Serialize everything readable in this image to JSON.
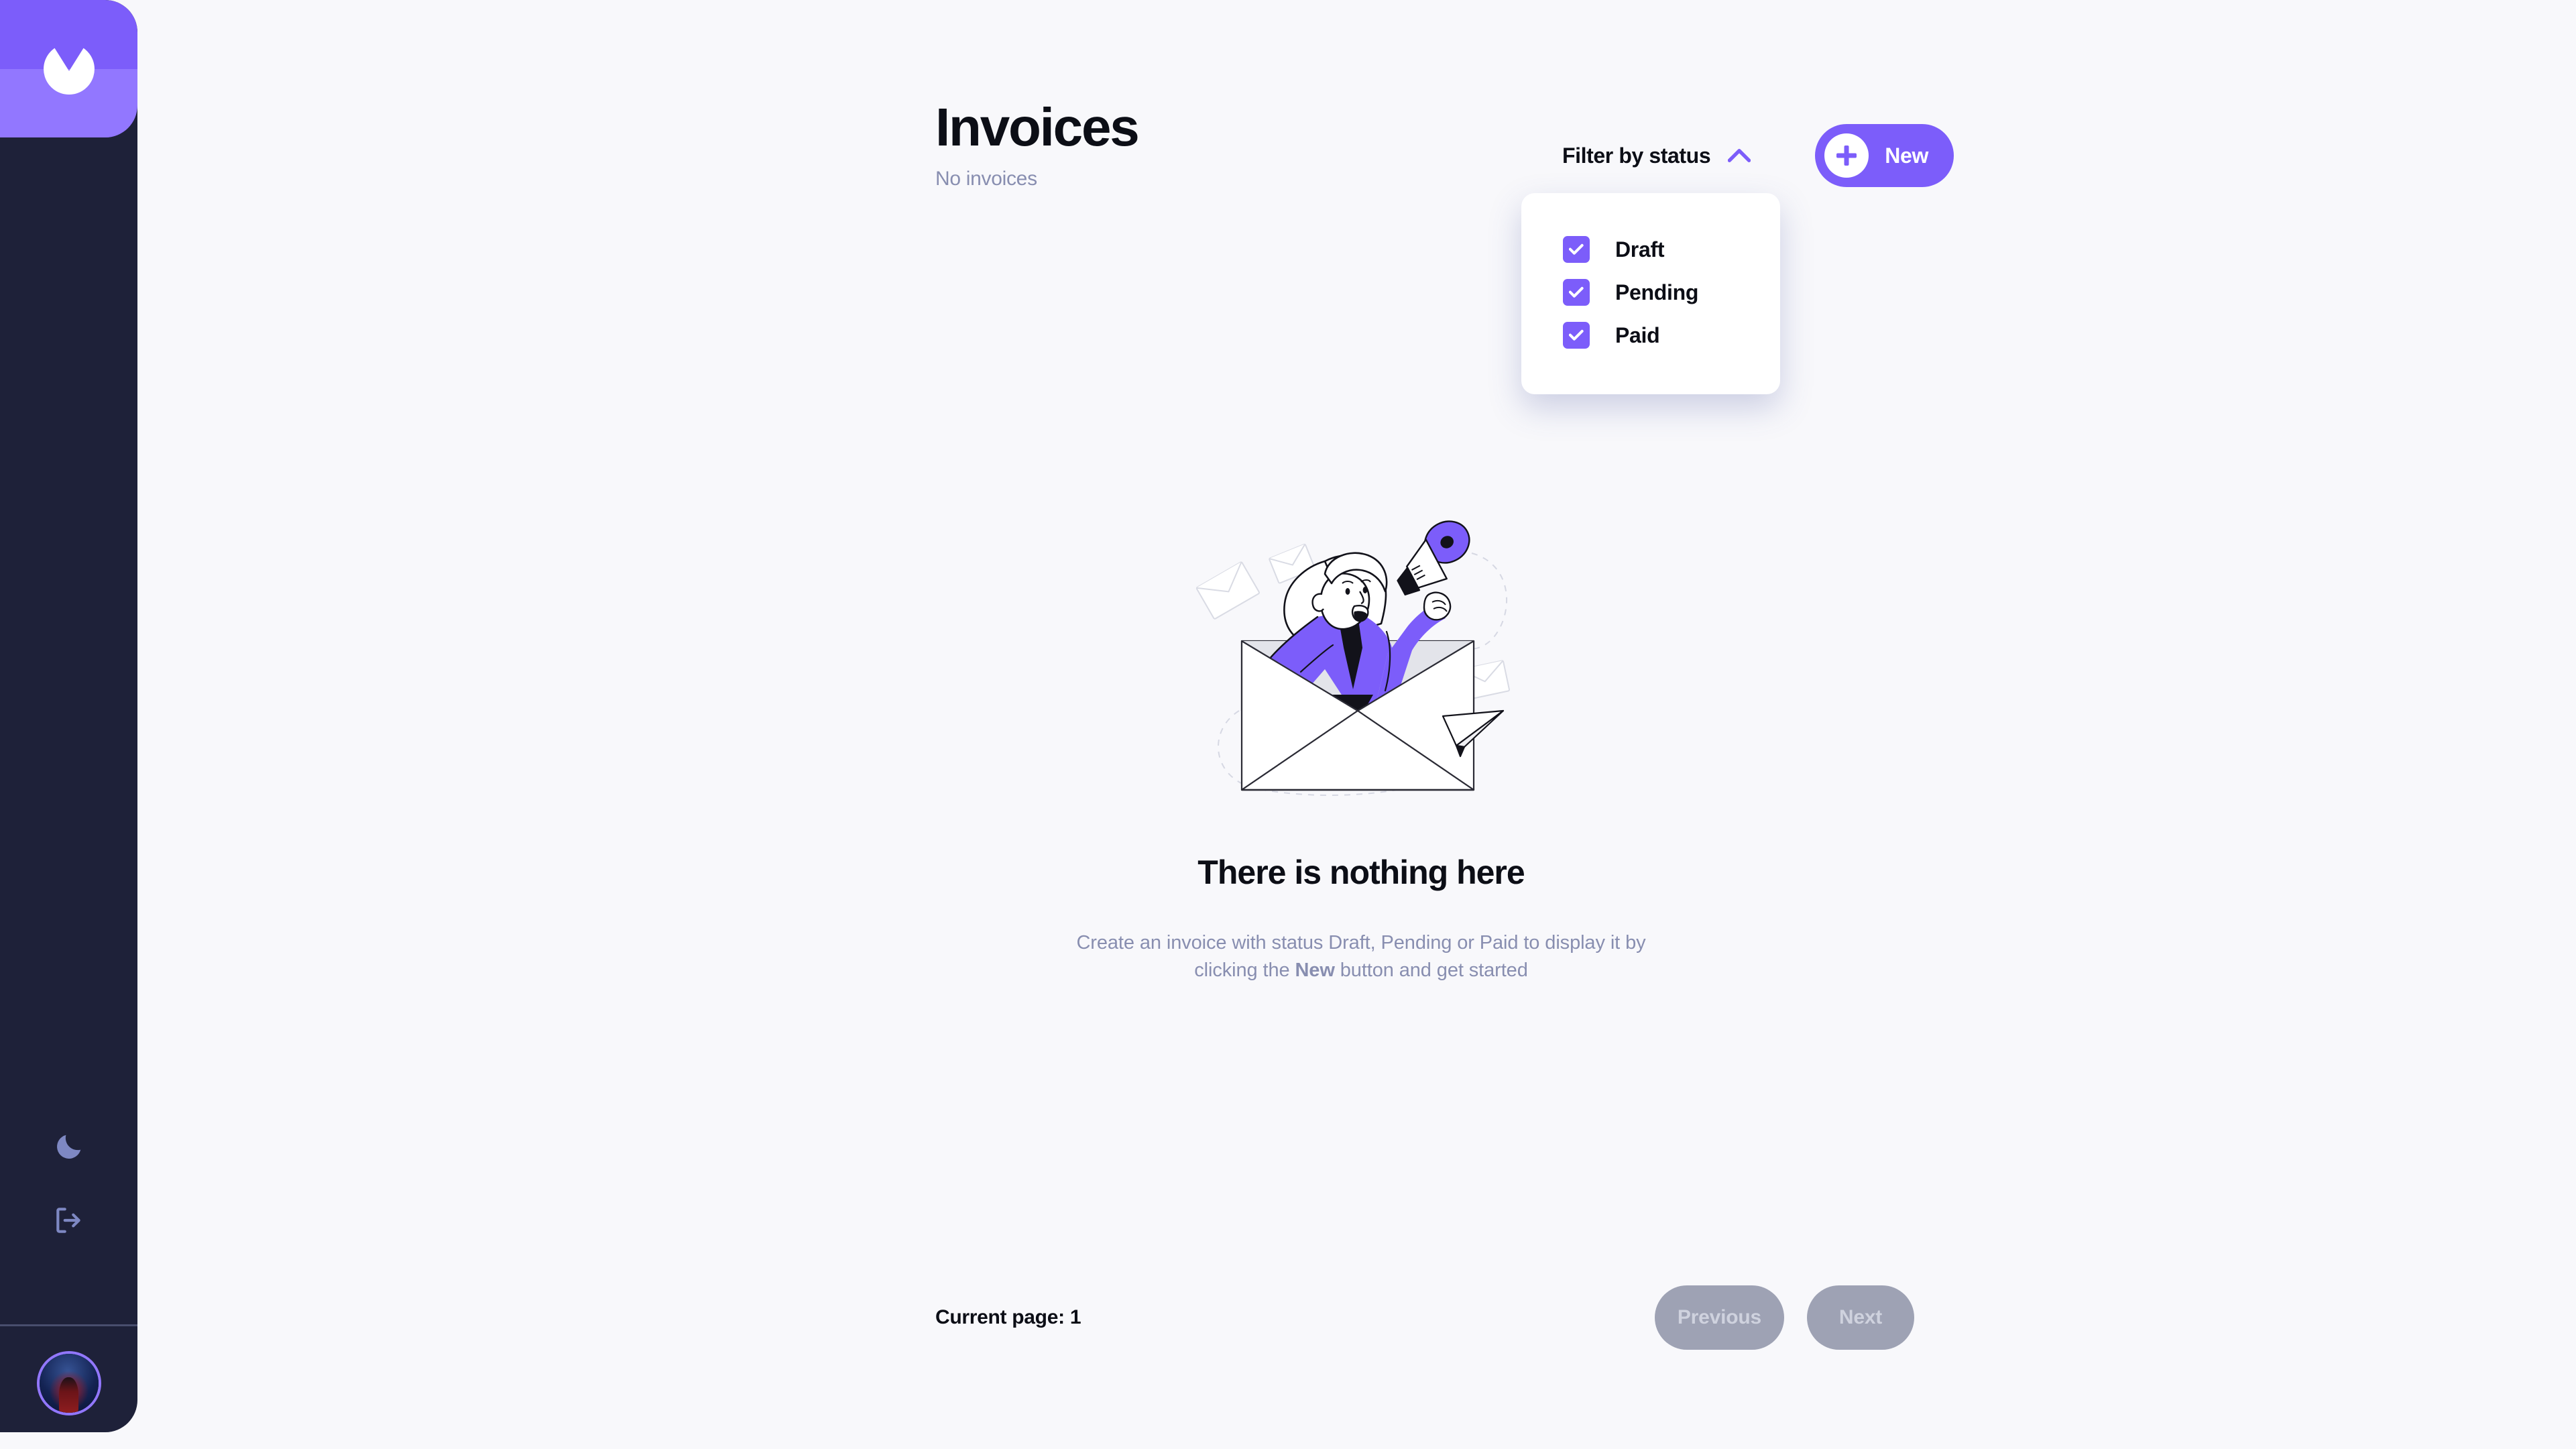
{
  "colors": {
    "accent": "#7c5dfa",
    "accent_light": "#9277ff",
    "sidebar_bg": "#1e2139",
    "page_bg": "#f8f8fb",
    "text_dark": "#0c0e16",
    "text_muted": "#888eb0",
    "icon_muted": "#7e88c3",
    "divider": "#494e6e",
    "disabled_btn": "#9ea2b4"
  },
  "sidebar": {
    "logo_name": "app-logo",
    "actions": [
      {
        "name": "theme-toggle",
        "icon": "moon-icon"
      },
      {
        "name": "logout",
        "icon": "logout-icon"
      }
    ],
    "avatar_alt": "user-avatar"
  },
  "header": {
    "title": "Invoices",
    "subtitle": "No invoices"
  },
  "filter": {
    "label": "Filter by status",
    "chevron": "chevron-up-icon",
    "expanded": true,
    "options": [
      {
        "label": "Draft",
        "checked": true
      },
      {
        "label": "Pending",
        "checked": true
      },
      {
        "label": "Paid",
        "checked": true
      }
    ]
  },
  "new_button": {
    "label": "New",
    "icon": "plus-icon"
  },
  "empty_state": {
    "illustration": "woman-with-megaphone-in-envelope-illustration",
    "title": "There is nothing here",
    "description_part1": "Create an invoice with status Draft, Pending or Paid to display it by clicking the ",
    "description_bold": "New",
    "description_part2": " button and get started"
  },
  "pagination": {
    "current_page_label": "Current page: 1",
    "previous_label": "Previous",
    "next_label": "Next",
    "previous_disabled": true,
    "next_disabled": true
  }
}
